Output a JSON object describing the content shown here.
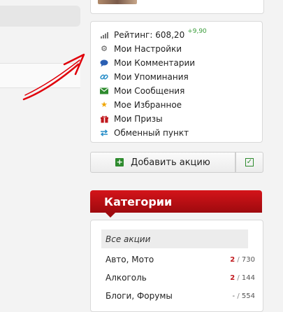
{
  "rating": {
    "label": "Рейтинг: 608,20",
    "delta": "+9,90"
  },
  "menu": [
    {
      "label": "Мои Настройки",
      "icon": "gear-icon",
      "color": "#555555"
    },
    {
      "label": "Мои Комментарии",
      "icon": "comment-icon",
      "color": "#2b5fb3"
    },
    {
      "label": "Мои Упоминания",
      "icon": "link-icon",
      "color": "#2a8fc9"
    },
    {
      "label": "Мои Сообщения",
      "icon": "envelope-icon",
      "color": "#2e8b2e"
    },
    {
      "label": "Мое Избранное",
      "icon": "star-icon",
      "color": "#f0a500"
    },
    {
      "label": "Мои Призы",
      "icon": "gift-icon",
      "color": "#c0171c"
    },
    {
      "label": "Обменный пункт",
      "icon": "exchange-icon",
      "color": "#2a8fc9"
    }
  ],
  "add_button": {
    "label": "Добавить акцию"
  },
  "categories": {
    "title": "Категории",
    "all_label": "Все акции",
    "items": [
      {
        "name": "Авто, Мото",
        "new": "2",
        "total": "730"
      },
      {
        "name": "Алкоголь",
        "new": "2",
        "total": "144"
      },
      {
        "name": "Блоги, Форумы",
        "new": "-",
        "total": "554"
      }
    ]
  },
  "colors": {
    "accent_red": "#c0171c",
    "green": "#2e8b2e",
    "annotation_arrow": "#e0000a"
  }
}
